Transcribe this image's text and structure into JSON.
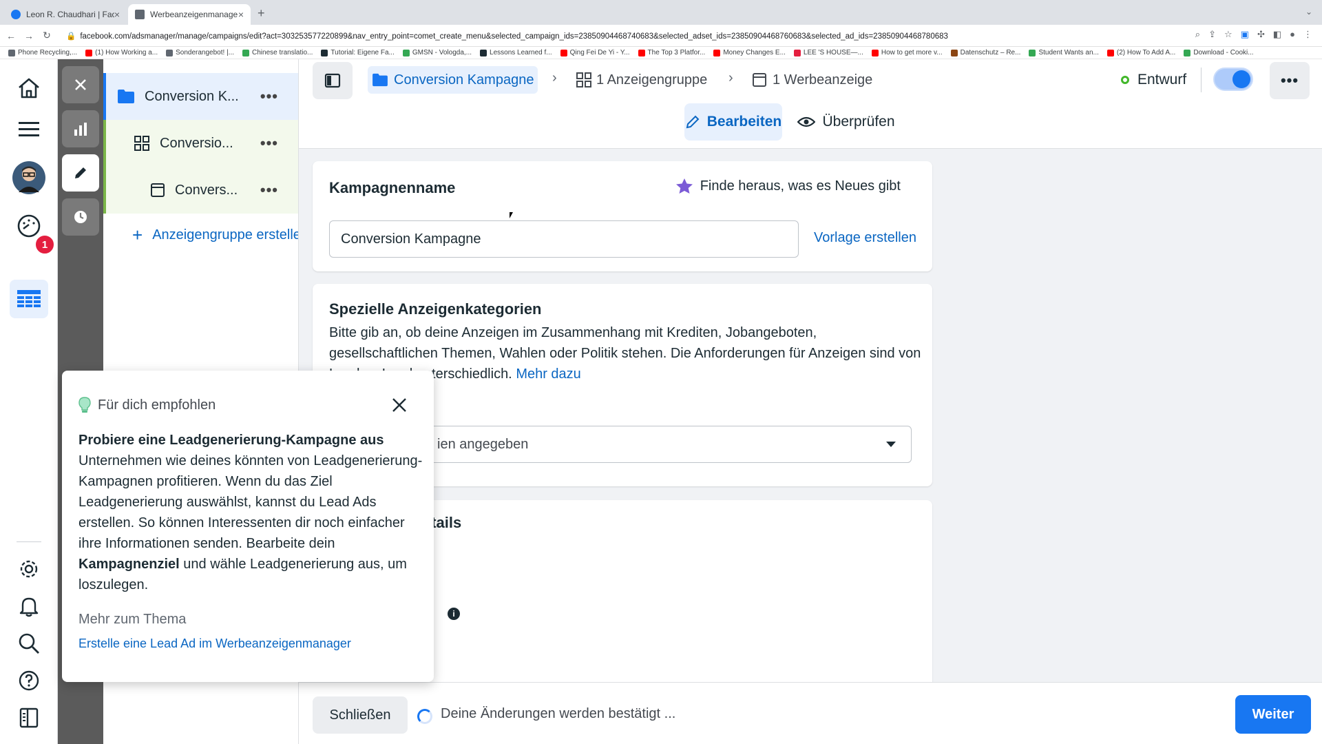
{
  "browser": {
    "tabs": [
      {
        "title": "Leon R. Chaudhari | Facebook",
        "favicon_color": "#1877f2"
      },
      {
        "title": "Werbeanzeigenmanager - Wer",
        "favicon_color": "#606770"
      }
    ],
    "url": "facebook.com/adsmanager/manage/campaigns/edit?act=303253577220899&nav_entry_point=comet_create_menu&selected_campaign_ids=23850904468740683&selected_adset_ids=23850904468760683&selected_ad_ids=23850904468780683",
    "bookmarks": [
      {
        "label": "Phone Recycling,...",
        "color": "#606770"
      },
      {
        "label": "(1) How Working a...",
        "color": "#ff0000"
      },
      {
        "label": "Sonderangebot! |...",
        "color": "#606770"
      },
      {
        "label": "Chinese translatio...",
        "color": "#34a853"
      },
      {
        "label": "Tutorial: Eigene Fa...",
        "color": "#1c2b33"
      },
      {
        "label": "GMSN - Vologda,...",
        "color": "#34a853"
      },
      {
        "label": "Lessons Learned f...",
        "color": "#1c2b33"
      },
      {
        "label": "Qing Fei De Yi - Y...",
        "color": "#ff0000"
      },
      {
        "label": "The Top 3 Platfor...",
        "color": "#ff0000"
      },
      {
        "label": "Money Changes E...",
        "color": "#ff0000"
      },
      {
        "label": "LEE 'S HOUSE—...",
        "color": "#e41e3f"
      },
      {
        "label": "How to get more v...",
        "color": "#ff0000"
      },
      {
        "label": "Datenschutz – Re...",
        "color": "#8b4513"
      },
      {
        "label": "Student Wants an...",
        "color": "#34a853"
      },
      {
        "label": "(2) How To Add A...",
        "color": "#ff0000"
      },
      {
        "label": "Download - Cooki...",
        "color": "#34a853"
      }
    ]
  },
  "leftnav": {
    "notification_count": "1"
  },
  "tree": {
    "campaign": "Conversion K...",
    "adset": "Conversio...",
    "ad": "Convers...",
    "add_adset": "Anzeigengruppe erstellen"
  },
  "breadcrumb": {
    "campaign": "Conversion Kampagne",
    "adsets": "1 Anzeigengruppe",
    "ads": "1 Werbeanzeige"
  },
  "status": {
    "label": "Entwurf"
  },
  "mode_tabs": {
    "edit": "Bearbeiten",
    "review": "Überprüfen"
  },
  "campaign_name_card": {
    "title": "Kampagnenname",
    "whats_new": "Finde heraus, was es Neues gibt",
    "input_value": "Conversion Kampagne",
    "template_link": "Vorlage erstellen"
  },
  "special_categories_card": {
    "title": "Spezielle Anzeigenkategorien",
    "description": "Bitte gib an, ob deine Anzeigen im Zusammenhang mit Krediten, Jobangeboten, gesellschaftlichen Themen, Wahlen oder Politik stehen. Die Anforderungen für Anzeigen sind von Land zu Land unterschiedlich.",
    "learn_more": "Mehr dazu",
    "select_value": "ien angegeben"
  },
  "details_card": {
    "title": "etails"
  },
  "bottombar": {
    "close": "Schließen",
    "confirm_text": "Deine Änderungen werden bestätigt ...",
    "next": "Weiter"
  },
  "popover": {
    "header": "Für dich empfohlen",
    "heading": "Probiere eine Leadgenerierung-Kampagne aus",
    "body_part1": "Unternehmen wie deines könnten von Leadgenerierung-Kampagnen profitieren. Wenn du das Ziel Leadgenerierung auswählst, kannst du Lead Ads erstellen. So können Interessenten dir noch einfacher ihre Informationen senden. Bearbeite dein",
    "body_bold": "Kampagnenziel",
    "body_part2": "und wähle Leadgenerierung aus, um loszulegen.",
    "more_label": "Mehr zum Thema",
    "link": "Erstelle eine Lead Ad im Werbeanzeigenmanager"
  },
  "colors": {
    "accent": "#1877f2",
    "link": "#0a66c2",
    "status_green": "#42b72a",
    "badge_red": "#e41e3f"
  }
}
